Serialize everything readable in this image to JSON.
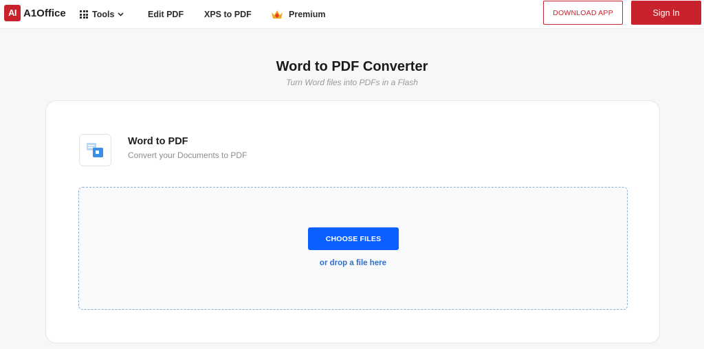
{
  "header": {
    "logo_mark": "AI",
    "logo_text": "A1Office",
    "nav": {
      "tools": "Tools",
      "edit_pdf": "Edit PDF",
      "xps_to_pdf": "XPS to PDF",
      "premium": "Premium"
    },
    "download_app": "DOWNLOAD APP",
    "sign_in": "Sign In"
  },
  "page": {
    "title": "Word to PDF Converter",
    "subtitle": "Turn Word files into PDFs in a Flash"
  },
  "tool": {
    "icon": "word-to-pdf-icon",
    "title": "Word to PDF",
    "description": "Convert your Documents to PDF"
  },
  "upload": {
    "choose_files": "CHOOSE FILES",
    "drop_hint": "or drop a file here"
  },
  "colors": {
    "brand": "#c8222c",
    "primary": "#0a60ff",
    "link": "#2f6fd0"
  }
}
